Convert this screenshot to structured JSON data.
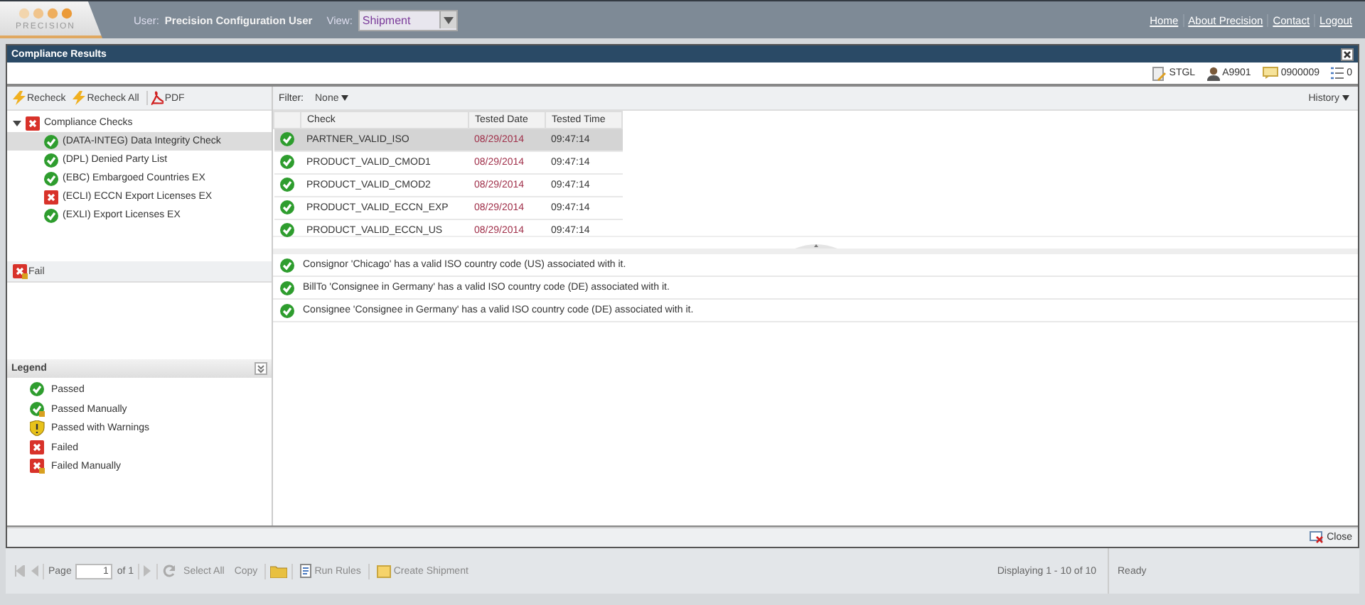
{
  "header": {
    "logo": "PRECISION",
    "user_label": "User:",
    "user": "Precision Configuration User",
    "view_label": "View:",
    "view_value": "Shipment",
    "links": [
      "Home",
      "About Precision",
      "Contact",
      "Logout"
    ]
  },
  "dialog": {
    "title": "Compliance Results",
    "info": [
      {
        "kind": "document",
        "text": "STGL"
      },
      {
        "kind": "person",
        "text": "A9901"
      },
      {
        "kind": "note",
        "text": "0900009"
      },
      {
        "kind": "list",
        "text": "0"
      }
    ]
  },
  "toolbar": [
    {
      "kind": "bolt",
      "label": "Recheck"
    },
    {
      "kind": "bolt",
      "label": "Recheck All"
    },
    {
      "kind": "pdf",
      "label": "PDF"
    }
  ],
  "tree": {
    "label": "Compliance Checks",
    "kind": "failed",
    "expanded": true,
    "children": [
      {
        "label": "(DATA-INTEG) Data Integrity Check",
        "kind": "passed",
        "selected": true
      },
      {
        "label": "(DPL) Denied Party List",
        "kind": "passed",
        "selected": false
      },
      {
        "label": "(EBC) Embargoed Countries EX",
        "kind": "passed",
        "selected": false
      },
      {
        "label": "(ECLI) ECCN Export Licenses EX",
        "kind": "failed",
        "selected": false
      },
      {
        "label": "(EXLI) Export Licenses EX",
        "kind": "passed",
        "selected": false
      }
    ]
  },
  "filter": {
    "label": "Filter:",
    "value": "None"
  },
  "history": "History",
  "table": {
    "columns": [
      "Check",
      "Tested Date",
      "Tested Time"
    ],
    "rows": [
      {
        "kind": "passed",
        "check": "PARTNER_VALID_ISO",
        "date": "08/29/2014",
        "time": "09:47:14",
        "selected": true
      },
      {
        "kind": "passed",
        "check": "PRODUCT_VALID_CMOD1",
        "date": "08/29/2014",
        "time": "09:47:14",
        "selected": false
      },
      {
        "kind": "passed",
        "check": "PRODUCT_VALID_CMOD2",
        "date": "08/29/2014",
        "time": "09:47:14",
        "selected": false
      },
      {
        "kind": "passed",
        "check": "PRODUCT_VALID_ECCN_EXP",
        "date": "08/29/2014",
        "time": "09:47:14",
        "selected": false
      },
      {
        "kind": "passed",
        "check": "PRODUCT_VALID_ECCN_US",
        "date": "08/29/2014",
        "time": "09:47:14",
        "selected": false
      }
    ]
  },
  "messages": [
    {
      "kind": "passed",
      "text": "Consignor 'Chicago' has a valid ISO country code (US) associated with it."
    },
    {
      "kind": "passed",
      "text": "BillTo 'Consignee in Germany' has a valid ISO country code (DE) associated with it."
    },
    {
      "kind": "passed",
      "text": "Consignee 'Consignee in Germany' has a valid ISO country code (DE) associated with it."
    }
  ],
  "fail_panel": {
    "kind": "failed_manual",
    "label": "Fail"
  },
  "legend": {
    "title": "Legend",
    "items": [
      {
        "kind": "passed",
        "label": "Passed"
      },
      {
        "kind": "passed_manual",
        "label": "Passed Manually"
      },
      {
        "kind": "warning",
        "label": "Passed with Warnings"
      },
      {
        "kind": "failed",
        "label": "Failed"
      },
      {
        "kind": "failed_manual",
        "label": "Failed Manually"
      }
    ]
  },
  "close": "Close",
  "pager": {
    "page_label": "Page",
    "page": "1",
    "of": "of 1",
    "select_all": "Select All",
    "copy": "Copy",
    "run_rules": "Run Rules",
    "create": "Create Shipment",
    "display": "Displaying 1 - 10 of 10"
  },
  "status": "Ready"
}
